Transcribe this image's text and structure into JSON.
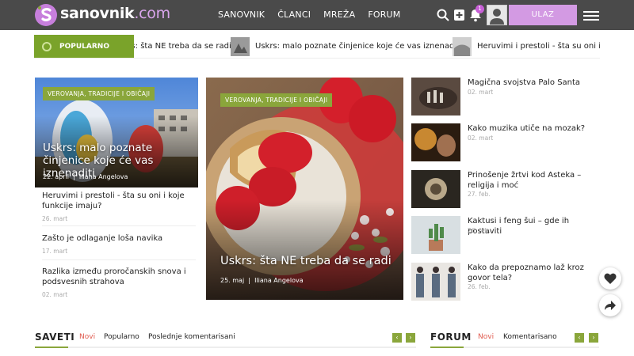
{
  "brand": {
    "name": "sanovnik",
    "tld": ".com",
    "accent": "#d39ae3",
    "green": "#8aa63b"
  },
  "nav": [
    "SANOVNIK",
    "ČLANCI",
    "MREŽA",
    "FORUM"
  ],
  "header": {
    "notification_count": "1",
    "login_label": "ULAZ",
    "icons": [
      "search-icon",
      "add-icon",
      "bell-icon",
      "user-icon",
      "menu-icon"
    ]
  },
  "ticker": {
    "label": "POPULARNO DANAS",
    "items": [
      "Uskrs: šta NE treba da se radi",
      "Uskrs: malo poznate činjenice koje će vas iznenaditi",
      "Heruvimi i prestoli - šta su oni i koje funkcije imaju?"
    ]
  },
  "left_feature": {
    "tag": "VEROVANJA, TRADICIJE I OBIČAJI",
    "title": "Uskrs: malo poznate činjenice koje će vas iznenaditi",
    "date": "22. april",
    "author": "Iliana Angelova"
  },
  "left_list": [
    {
      "title": "Heruvimi i prestoli - šta su oni i koje funkcije imaju?",
      "date": "26. mart"
    },
    {
      "title": "Zašto je odlaganje loša navika",
      "date": "17. mart"
    },
    {
      "title": "Razlika između proročanskih snova i podsvesnih strahova",
      "date": "02. mart"
    }
  ],
  "center_feature": {
    "tag": "VEROVANJA, TRADICIJE I OBIČAJI",
    "title": "Uskrs: šta NE treba da se radi",
    "date": "25. maj",
    "author": "Iliana Angelova"
  },
  "right_list": [
    {
      "title": "Magična svojstva Palo Santa",
      "date": "02. mart"
    },
    {
      "title": "Kako muzika utiče na mozak?",
      "date": "02. mart"
    },
    {
      "title": "Prinošenje žrtvi kod Asteka – religija i moć",
      "date": "27. feb."
    },
    {
      "title": "Kaktusi i feng šui – gde ih postaviti",
      "date": "26. feb."
    },
    {
      "title": "Kako da prepoznamo laž kroz govor tela?",
      "date": "26. feb."
    }
  ],
  "meta_sep": "|",
  "sections": {
    "saveti": {
      "title": "SAVETI",
      "tabs": [
        "Novi",
        "Popularno",
        "Poslednje komentarisani"
      ]
    },
    "forum": {
      "title": "FORUM",
      "tabs": [
        "Novi",
        "Komentarisano"
      ]
    },
    "arrows": {
      "prev": "‹",
      "next": "›"
    }
  },
  "floating": [
    "heart-icon",
    "share-icon"
  ]
}
